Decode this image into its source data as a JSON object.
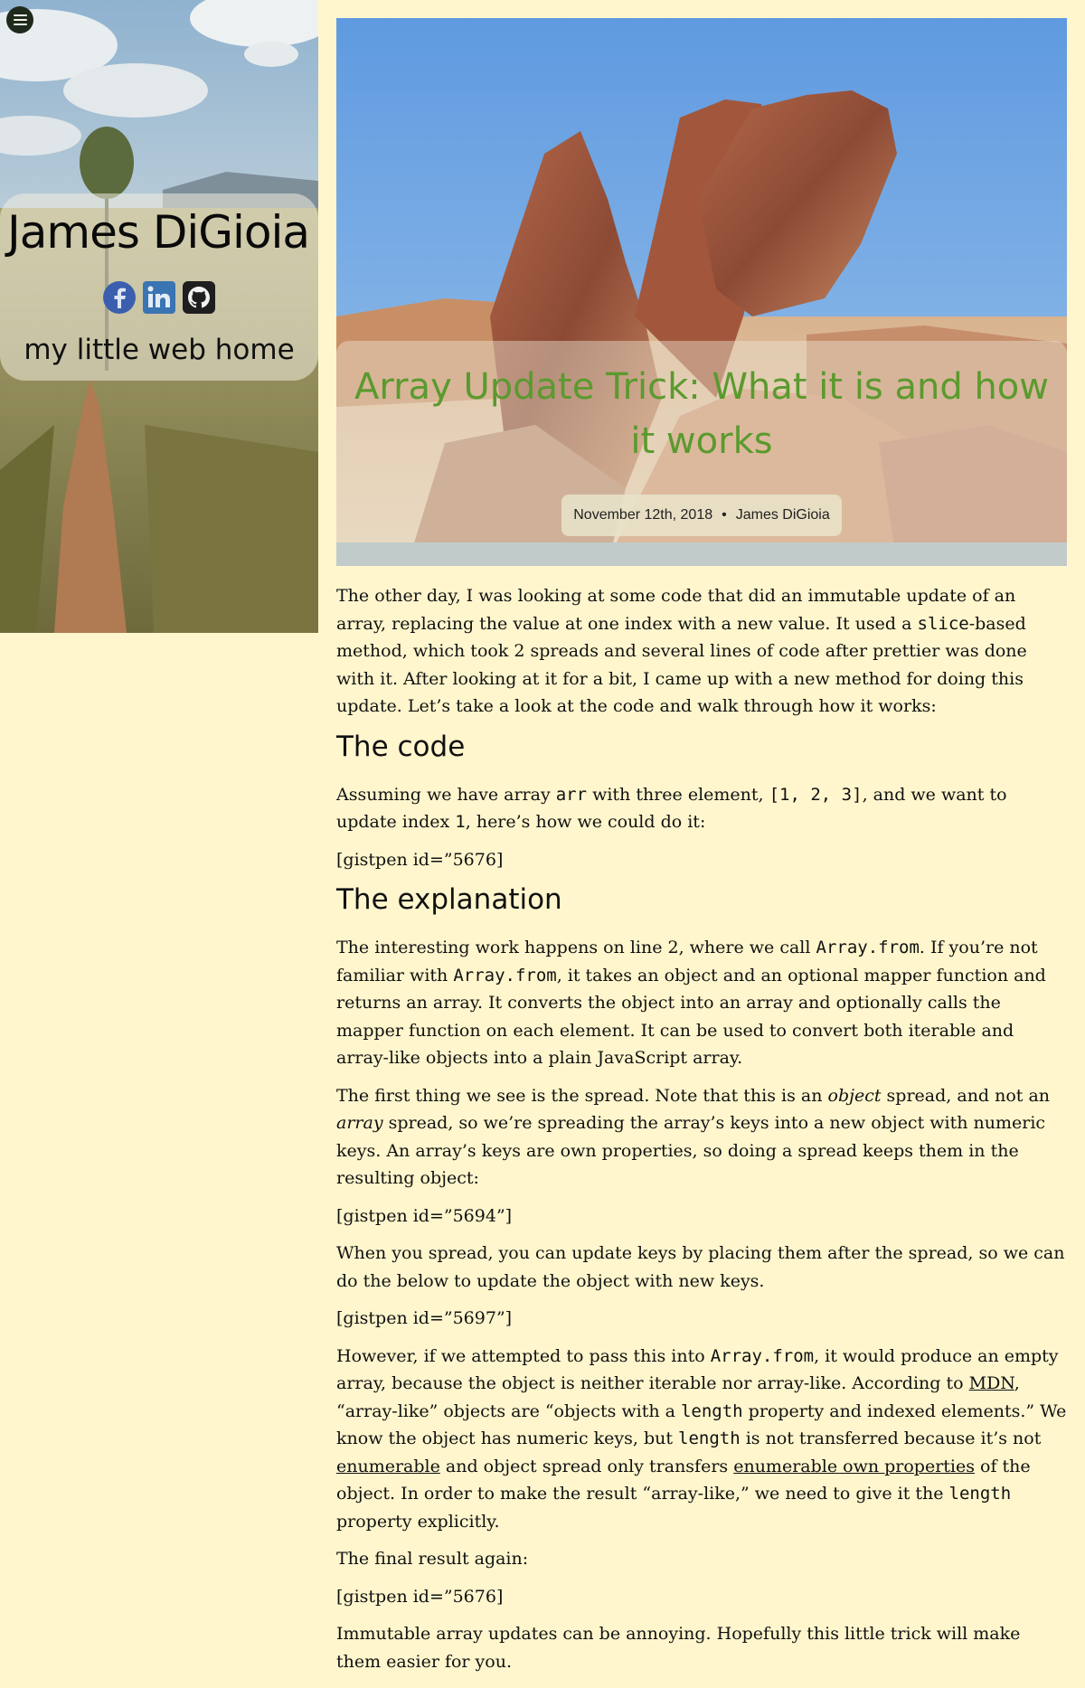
{
  "sidebar": {
    "menu_icon": "hamburger-menu-icon",
    "site_title": "James DiGioia",
    "tagline": "my little web home",
    "social_icons": [
      "facebook-icon",
      "linkedin-icon",
      "github-icon"
    ]
  },
  "post": {
    "title": "Array Update Trick: What it is and how it works",
    "date": "November 12th, 2018",
    "separator": "•",
    "author": "James DiGioia",
    "title_color": "#5a9a2e"
  },
  "article": {
    "p1_a": "The other day, I was looking at some code that did an immutable update of an array, replacing the value at one index with a new value. It used a ",
    "p1_code": "slice",
    "p1_b": "-based method, which took 2 spreads and several lines of code after prettier was done with it. After looking at it for a bit, I came up with a new method for doing this update. Let’s take a look at the code and walk through how it works:",
    "h_code": "The code",
    "p2_a": "Assuming we have array ",
    "p2_code1": "arr",
    "p2_b": " with three element, ",
    "p2_code2": "[1, 2, 3]",
    "p2_c": ", and we want to update index ",
    "p2_code3": "1",
    "p2_d": ", here’s how we could do it:",
    "gist1": "[gistpen id=”5676]",
    "h_explanation": "The explanation",
    "p3_a": "The interesting work happens on line 2, where we call ",
    "p3_code1": "Array.from",
    "p3_b": ". If you’re not familiar with ",
    "p3_code2": "Array.from",
    "p3_c": ", it takes an object and an optional mapper function and returns an array. It converts the object into an array and optionally calls the mapper function on each element. It can be used to convert both iterable and array-like objects into a plain JavaScript array.",
    "p4_a": "The first thing we see is the spread. Note that this is an ",
    "p4_em1": "object",
    "p4_b": " spread, and not an ",
    "p4_em2": "array",
    "p4_c": " spread, so we’re spreading the array’s keys into a new object with numeric keys. An array’s keys are own properties, so doing a spread keeps them in the resulting object:",
    "gist2": "[gistpen id=”5694”]",
    "p5": "When you spread, you can update keys by placing them after the spread, so we can do the below to update the object with new keys.",
    "gist3": "[gistpen id=”5697”]",
    "p6_a": "However, if we attempted to pass this into ",
    "p6_code1": "Array.from",
    "p6_b": ", it would produce an empty array, because the object is neither iterable nor array-like. According to ",
    "p6_link1": "MDN",
    "p6_c": ", “array-like” objects are “objects with a ",
    "p6_code2": "length",
    "p6_d": " property and indexed elements.” We know the object has numeric keys, but ",
    "p6_code3": "length",
    "p6_e": " is not transferred because it’s not ",
    "p6_link2": "enumerable",
    "p6_f": " and object spread only transfers ",
    "p6_link3": "enumerable own properties",
    "p6_g": " of the object. In order to make the result “array-like,” we need to give it the ",
    "p6_code4": "length",
    "p6_h": " property explicitly.",
    "p7": "The final result again:",
    "gist4": "[gistpen id=”5676]",
    "p8": "Immutable array updates can be annoying. Hopefully this little trick will make them easier for you."
  }
}
